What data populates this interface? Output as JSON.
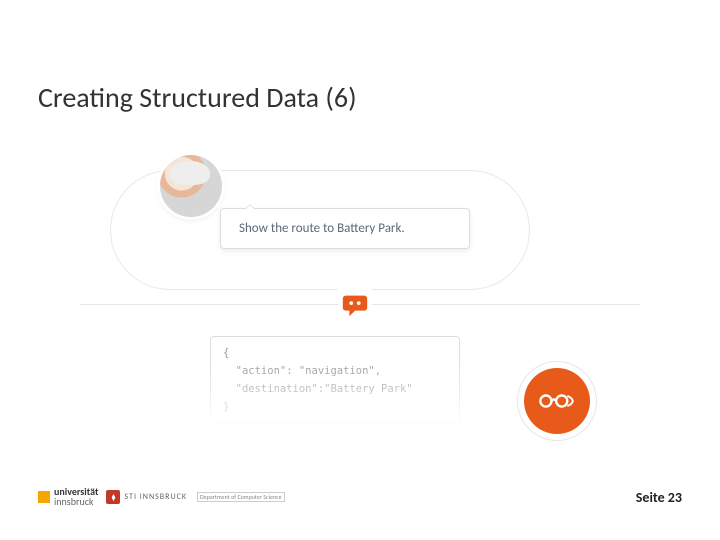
{
  "title": "Creating Structured Data (6)",
  "user_query": "Show the route to Battery Park.",
  "code": "{\n  \"action\": \"navigation\",\n  \"destination\":\"Battery Park\"\n}",
  "footer": {
    "uni_top": "universität",
    "uni_bottom": "innsbruck",
    "sti": "STI INNSBRUCK",
    "dept": "Department of\nComputer Science",
    "page": "Seite 23"
  }
}
